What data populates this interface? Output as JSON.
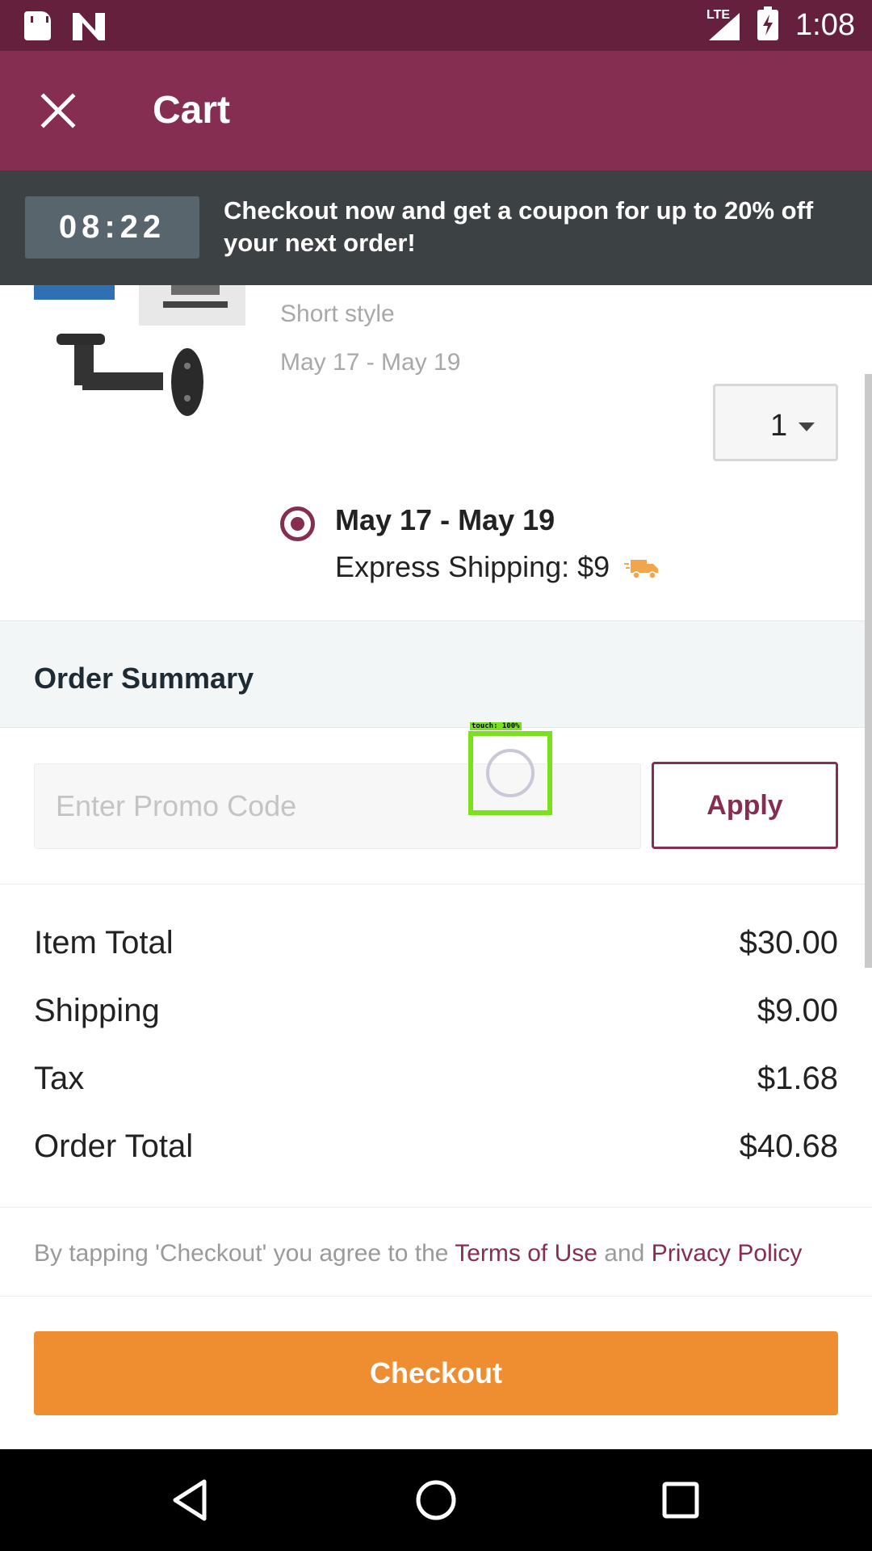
{
  "status_bar": {
    "time": "1:08",
    "network": "LTE"
  },
  "app_bar": {
    "title": "Cart"
  },
  "banner": {
    "timer": "08:22",
    "message": "Checkout now and get a coupon for up to 20% off your next order!"
  },
  "product": {
    "variant": "Short style",
    "delivery_range": "May 17 - May 19",
    "quantity": "1",
    "shipping_option": {
      "date": "May 17 - May 19",
      "label": "Express Shipping: $9",
      "selected": true
    }
  },
  "order_summary": {
    "title": "Order Summary",
    "promo_placeholder": "Enter Promo Code",
    "apply_label": "Apply",
    "rows": [
      {
        "label": "Item Total",
        "value": "$30.00"
      },
      {
        "label": "Shipping",
        "value": "$9.00"
      },
      {
        "label": "Tax",
        "value": "$1.68"
      },
      {
        "label": "Order Total",
        "value": "$40.68"
      }
    ]
  },
  "terms": {
    "prefix": "By tapping 'Checkout' you agree to the ",
    "terms_link": "Terms of Use",
    "middle": " and ",
    "privacy_link": "Privacy Policy"
  },
  "checkout_label": "Checkout",
  "touch_overlay": {
    "label": "touch: 100%"
  },
  "colors": {
    "status_bar": "#65203e",
    "app_bar": "#862e52",
    "banner": "#3c4243",
    "accent": "#862e52",
    "checkout": "#ee8e30"
  }
}
